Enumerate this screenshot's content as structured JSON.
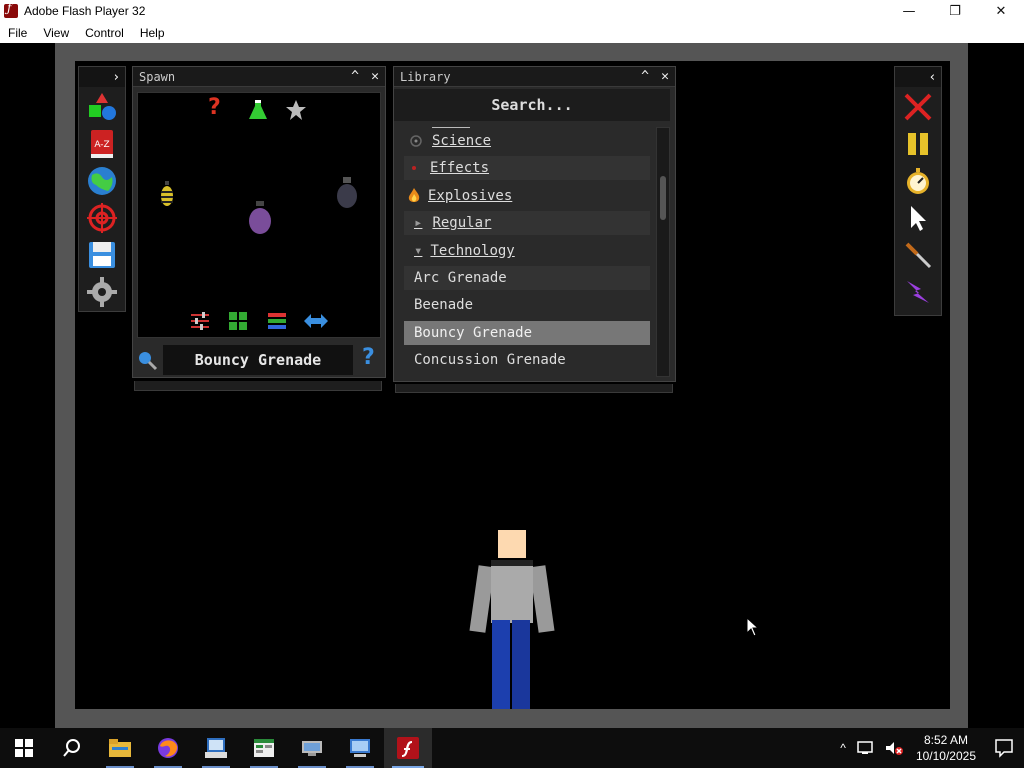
{
  "window": {
    "title": "Adobe Flash Player 32",
    "minimize": "—",
    "restore": "❐",
    "close": "✕"
  },
  "menu": [
    "File",
    "View",
    "Control",
    "Help"
  ],
  "left_toolbar": {
    "collapse": "›",
    "tools": [
      "shapes-icon",
      "a-z-icon",
      "globe-icon",
      "target-icon",
      "save-icon",
      "gear-icon"
    ],
    "az_label": "A-Z"
  },
  "spawn": {
    "title": "Spawn",
    "minimize": "^",
    "close": "✕",
    "top_icons": [
      "question-icon",
      "flask-icon",
      "star-icon"
    ],
    "bottom_icons": [
      "sliders-icon",
      "grid-icon",
      "list-icon",
      "swap-icon"
    ],
    "question_glyph": "?",
    "selected_item": "Bouncy Grenade",
    "help_glyph": "?"
  },
  "library": {
    "title": "Library",
    "minimize": "^",
    "close": "✕",
    "search_placeholder": "Search...",
    "items": [
      {
        "label": "Science",
        "type": "category",
        "style": "normal"
      },
      {
        "label": "Effects",
        "type": "category",
        "style": "alt"
      },
      {
        "label": "Explosives",
        "type": "category",
        "style": "normal"
      },
      {
        "label": "Regular",
        "type": "subcategory",
        "style": "alt",
        "arrow": "▸"
      },
      {
        "label": "Technology",
        "type": "subcategory",
        "style": "normal",
        "arrow": "▾"
      },
      {
        "label": "Arc Grenade",
        "type": "item",
        "style": "alt"
      },
      {
        "label": "Beenade",
        "type": "item",
        "style": "normal"
      },
      {
        "label": "Bouncy Grenade",
        "type": "item",
        "style": "selected"
      },
      {
        "label": "Concussion Grenade",
        "type": "item",
        "style": "normal"
      }
    ]
  },
  "right_toolbar": {
    "collapse": "‹",
    "tools": [
      "delete-icon",
      "pause-icon",
      "stopwatch-icon",
      "pointer-icon",
      "knife-icon",
      "lightning-icon"
    ]
  },
  "taskbar": {
    "apps": [
      "start-icon",
      "search-icon",
      "file-explorer-icon",
      "firefox-icon",
      "app-window-icon",
      "spreadsheet-icon",
      "network-icon",
      "display-icon",
      "flash-player-icon"
    ],
    "time": "8:52 AM",
    "date": "10/10/2025",
    "tray_up": "^"
  },
  "colors": {
    "stage": "#000000",
    "panel": "#2a2a2a",
    "selected_row": "#777777"
  }
}
